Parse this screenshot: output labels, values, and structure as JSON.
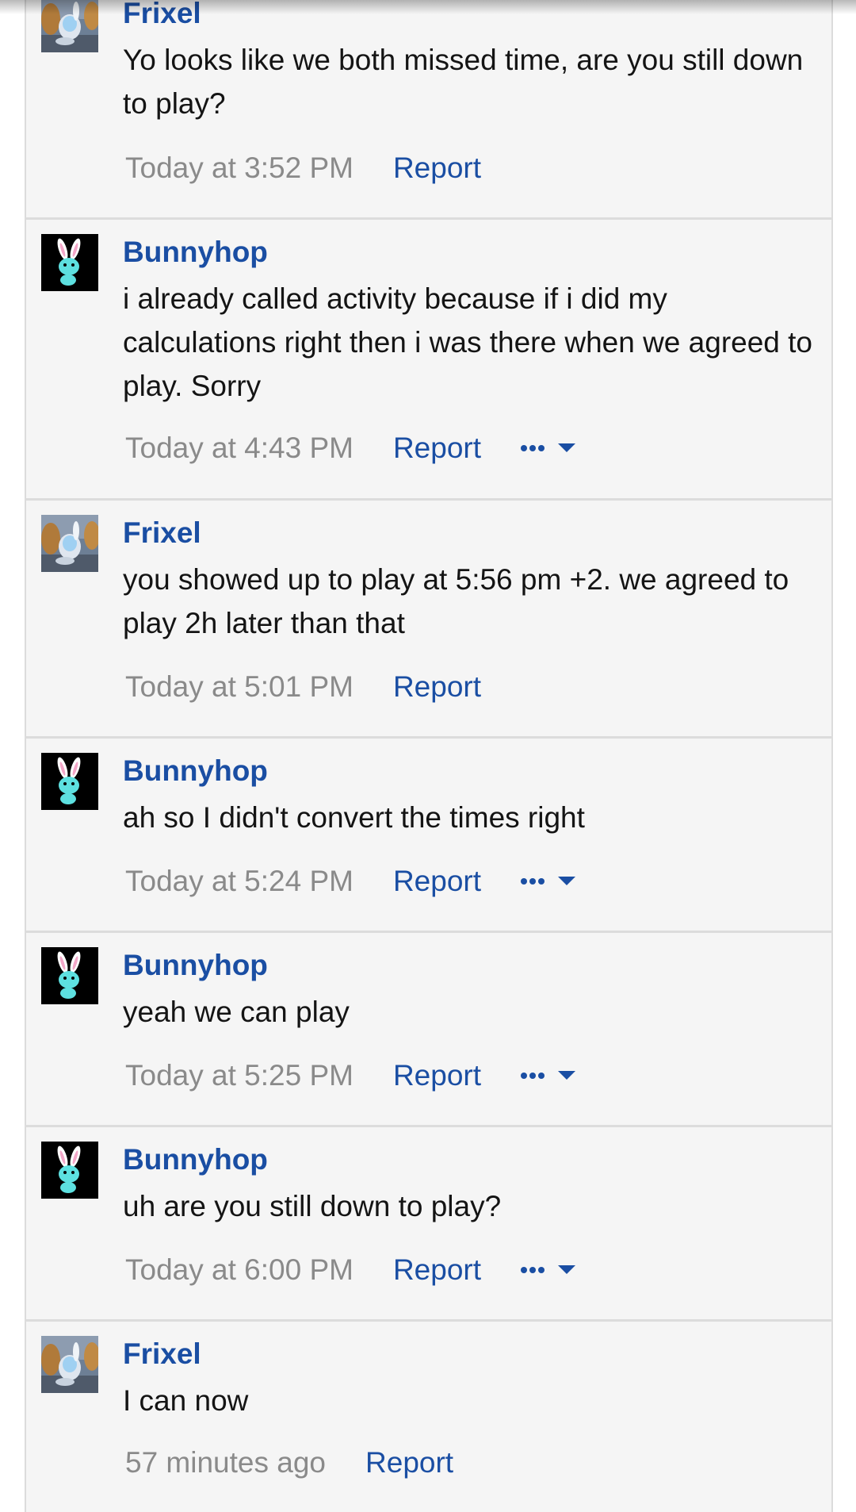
{
  "colors": {
    "author": "#1a4ea3",
    "link": "#1a4ea3",
    "timestamp": "#8a8a8a",
    "text": "#141414",
    "card_background": "#f5f5f5",
    "divider": "#dcdcdc"
  },
  "icons": {
    "frixel_avatar": "frixel-avatar",
    "bunnyhop_avatar": "bunnyhop-avatar",
    "more_actions": "more-actions-icon"
  },
  "messages": [
    {
      "author": "Frixel",
      "avatar": "frixel",
      "text": "Yo looks like we both missed time, are you still down to play?",
      "time": "Today at 3:52 PM",
      "report": "Report",
      "has_more_menu": false
    },
    {
      "author": "Bunnyhop",
      "avatar": "bunnyhop",
      "text": "i already called activity because if i did my calculations right then i was there when we agreed to play. Sorry",
      "time": "Today at 4:43 PM",
      "report": "Report",
      "has_more_menu": true
    },
    {
      "author": "Frixel",
      "avatar": "frixel",
      "text": "you showed up to play at 5:56 pm +2. we agreed to play 2h later than that",
      "time": "Today at 5:01 PM",
      "report": "Report",
      "has_more_menu": false
    },
    {
      "author": "Bunnyhop",
      "avatar": "bunnyhop",
      "text": "ah so I didn't convert the times right",
      "time": "Today at 5:24 PM",
      "report": "Report",
      "has_more_menu": true
    },
    {
      "author": "Bunnyhop",
      "avatar": "bunnyhop",
      "text": "yeah we can play",
      "time": "Today at 5:25 PM",
      "report": "Report",
      "has_more_menu": true
    },
    {
      "author": "Bunnyhop",
      "avatar": "bunnyhop",
      "text": "uh are you still down to play?",
      "time": "Today at 6:00 PM",
      "report": "Report",
      "has_more_menu": true
    },
    {
      "author": "Frixel",
      "avatar": "frixel",
      "text": "I can now",
      "time": "57 minutes ago",
      "report": "Report",
      "has_more_menu": false
    }
  ]
}
